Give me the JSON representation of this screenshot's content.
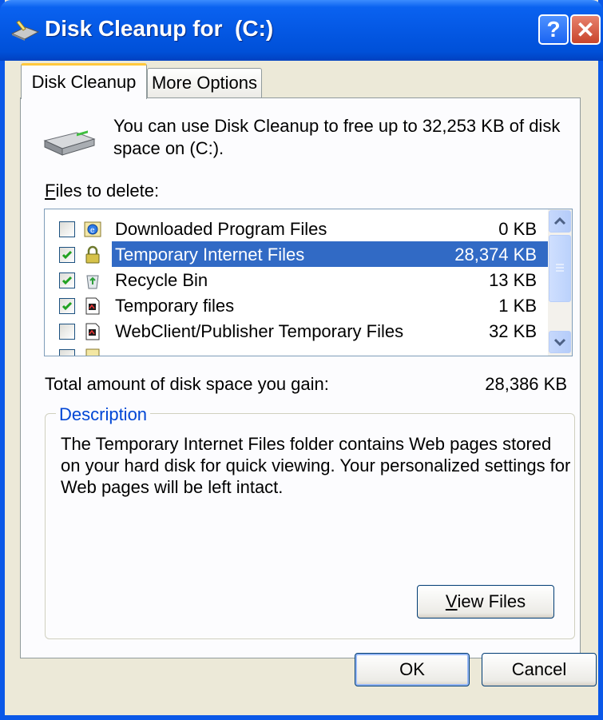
{
  "window": {
    "title": "Disk Cleanup for  (C:)",
    "help_label": "?",
    "close_label": "✕"
  },
  "tabs": [
    {
      "label": "Disk Cleanup",
      "active": true
    },
    {
      "label": "More Options",
      "active": false
    }
  ],
  "intro": "You can use Disk Cleanup to free up to 32,253 KB of disk space on  (C:).",
  "files_label_first": "F",
  "files_label_rest": "iles to delete:",
  "files": [
    {
      "name": "Downloaded Program Files",
      "size": "0 KB",
      "checked": false,
      "icon": "ie-icon"
    },
    {
      "name": "Temporary Internet Files",
      "size": "28,374 KB",
      "checked": true,
      "icon": "lock-icon",
      "selected": true
    },
    {
      "name": "Recycle Bin",
      "size": "13 KB",
      "checked": true,
      "icon": "recycle-bin-icon"
    },
    {
      "name": "Temporary files",
      "size": "1 KB",
      "checked": true,
      "icon": "temp-file-icon"
    },
    {
      "name": "WebClient/Publisher Temporary Files",
      "size": "32 KB",
      "checked": false,
      "icon": "temp-file-icon"
    }
  ],
  "total": {
    "label": "Total amount of disk space you gain:",
    "value": "28,386 KB"
  },
  "description": {
    "legend": "Description",
    "text": "The Temporary Internet Files folder contains Web pages stored on your hard disk for quick viewing. Your personalized settings for Web pages will be left intact."
  },
  "buttons": {
    "view_files_first": "V",
    "view_files_rest": "iew Files",
    "ok": "OK",
    "cancel": "Cancel"
  },
  "colors": {
    "titlebar": "#0458E4",
    "selection": "#316AC5",
    "legend": "#0046D5",
    "check": "#21A121"
  }
}
